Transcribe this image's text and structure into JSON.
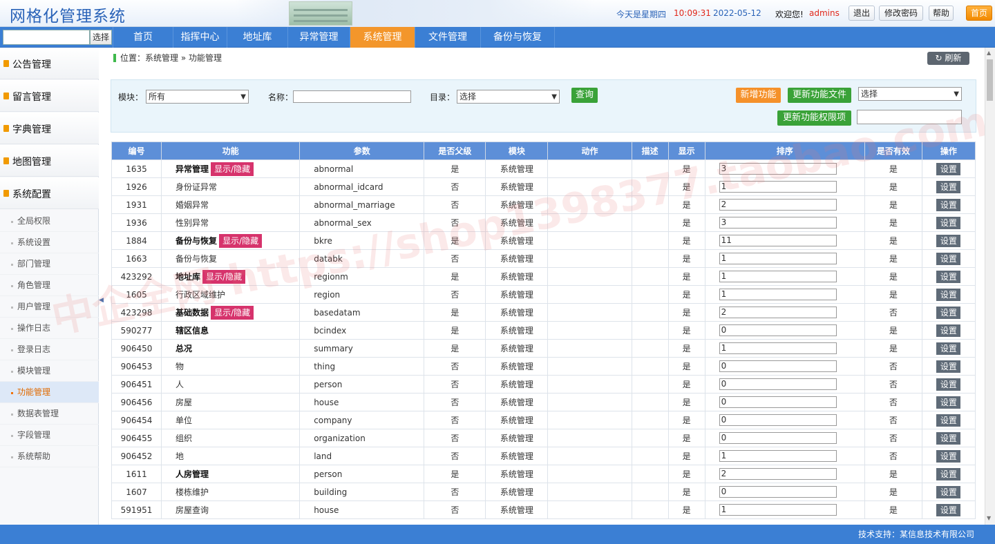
{
  "header": {
    "title": "网格化管理系统",
    "weekday": "今天是星期四",
    "time": "10:09:31",
    "date": "2022-05-12",
    "welcome": "欢迎您!",
    "user": "admins",
    "logout": "退出",
    "change_password": "修改密码",
    "help": "帮助",
    "home": "首页"
  },
  "nav": {
    "search_button": "选择",
    "items": [
      "首页",
      "指挥中心",
      "地址库",
      "异常管理",
      "系统管理",
      "文件管理",
      "备份与恢复"
    ],
    "active": "系统管理"
  },
  "sidebar": {
    "groups": [
      "公告管理",
      "留言管理",
      "字典管理",
      "地图管理",
      "系统配置"
    ],
    "items": [
      "全局权限",
      "系统设置",
      "部门管理",
      "角色管理",
      "用户管理",
      "操作日志",
      "登录日志",
      "模块管理",
      "功能管理",
      "数据表管理",
      "字段管理",
      "系统帮助"
    ],
    "active": "功能管理"
  },
  "breadcrumb": "位置：系统管理 » 功能管理",
  "refresh": "刷新",
  "filter": {
    "module_label": "模块：",
    "module_value": "所有",
    "name_label": "名称：",
    "dir_label": "目录：",
    "dir_value": "选择",
    "query": "查询",
    "add": "新增功能",
    "update_files": "更新功能文件",
    "select_value": "选择",
    "update_perm": "更新功能权限项"
  },
  "table": {
    "headers": [
      "编号",
      "功能",
      "参数",
      "是否父级",
      "模块",
      "动作",
      "描述",
      "显示",
      "排序",
      "是否有效",
      "操作"
    ],
    "toggle_label": "显示/隐藏",
    "set_label": "设置",
    "rows": [
      {
        "id": "1635",
        "name": "异常管理",
        "bold": true,
        "tag": true,
        "param": "abnormal",
        "parent": "是",
        "module": "系统管理",
        "show": "是",
        "order": "3",
        "valid": "是"
      },
      {
        "id": "1926",
        "name": "身份证异常",
        "bold": false,
        "tag": false,
        "param": "abnormal_idcard",
        "parent": "否",
        "module": "系统管理",
        "show": "是",
        "order": "1",
        "valid": "是"
      },
      {
        "id": "1931",
        "name": "婚姻异常",
        "bold": false,
        "tag": false,
        "param": "abnormal_marriage",
        "parent": "否",
        "module": "系统管理",
        "show": "是",
        "order": "2",
        "valid": "是"
      },
      {
        "id": "1936",
        "name": "性别异常",
        "bold": false,
        "tag": false,
        "param": "abnormal_sex",
        "parent": "否",
        "module": "系统管理",
        "show": "是",
        "order": "3",
        "valid": "是"
      },
      {
        "id": "1884",
        "name": "备份与恢复",
        "bold": true,
        "tag": true,
        "param": "bkre",
        "parent": "是",
        "module": "系统管理",
        "show": "是",
        "order": "11",
        "valid": "是"
      },
      {
        "id": "1663",
        "name": "备份与恢复",
        "bold": false,
        "tag": false,
        "param": "databk",
        "parent": "否",
        "module": "系统管理",
        "show": "是",
        "order": "1",
        "valid": "是"
      },
      {
        "id": "423292",
        "name": "地址库",
        "bold": true,
        "tag": true,
        "param": "regionm",
        "parent": "是",
        "module": "系统管理",
        "show": "是",
        "order": "1",
        "valid": "是"
      },
      {
        "id": "1605",
        "name": "行政区域维护",
        "bold": false,
        "tag": false,
        "param": "region",
        "parent": "否",
        "module": "系统管理",
        "show": "是",
        "order": "1",
        "valid": "是"
      },
      {
        "id": "423298",
        "name": "基础数据",
        "bold": true,
        "tag": true,
        "param": "basedatam",
        "parent": "是",
        "module": "系统管理",
        "show": "是",
        "order": "2",
        "valid": "否"
      },
      {
        "id": "590277",
        "name": "辖区信息",
        "bold": true,
        "tag": false,
        "param": "bcindex",
        "parent": "是",
        "module": "系统管理",
        "show": "是",
        "order": "0",
        "valid": "是"
      },
      {
        "id": "906450",
        "name": "总况",
        "bold": true,
        "tag": false,
        "param": "summary",
        "parent": "是",
        "module": "系统管理",
        "show": "是",
        "order": "1",
        "valid": "是"
      },
      {
        "id": "906453",
        "name": "物",
        "bold": false,
        "tag": false,
        "param": "thing",
        "parent": "否",
        "module": "系统管理",
        "show": "是",
        "order": "0",
        "valid": "否"
      },
      {
        "id": "906451",
        "name": "人",
        "bold": false,
        "tag": false,
        "param": "person",
        "parent": "否",
        "module": "系统管理",
        "show": "是",
        "order": "0",
        "valid": "否"
      },
      {
        "id": "906456",
        "name": "房屋",
        "bold": false,
        "tag": false,
        "param": "house",
        "parent": "否",
        "module": "系统管理",
        "show": "是",
        "order": "0",
        "valid": "否"
      },
      {
        "id": "906454",
        "name": "单位",
        "bold": false,
        "tag": false,
        "param": "company",
        "parent": "否",
        "module": "系统管理",
        "show": "是",
        "order": "0",
        "valid": "否"
      },
      {
        "id": "906455",
        "name": "组织",
        "bold": false,
        "tag": false,
        "param": "organization",
        "parent": "否",
        "module": "系统管理",
        "show": "是",
        "order": "0",
        "valid": "否"
      },
      {
        "id": "906452",
        "name": "地",
        "bold": false,
        "tag": false,
        "param": "land",
        "parent": "否",
        "module": "系统管理",
        "show": "是",
        "order": "1",
        "valid": "否"
      },
      {
        "id": "1611",
        "name": "人房管理",
        "bold": true,
        "tag": false,
        "param": "person",
        "parent": "是",
        "module": "系统管理",
        "show": "是",
        "order": "2",
        "valid": "是"
      },
      {
        "id": "1607",
        "name": "楼栋维护",
        "bold": false,
        "tag": false,
        "param": "building",
        "parent": "否",
        "module": "系统管理",
        "show": "是",
        "order": "0",
        "valid": "是"
      },
      {
        "id": "591951",
        "name": "房屋查询",
        "bold": false,
        "tag": false,
        "param": "house",
        "parent": "否",
        "module": "系统管理",
        "show": "是",
        "order": "1",
        "valid": "是"
      }
    ]
  },
  "footer": "技术支持：某信息技术有限公司",
  "watermark": "中企全网 https://shop1398377.taobao.com"
}
